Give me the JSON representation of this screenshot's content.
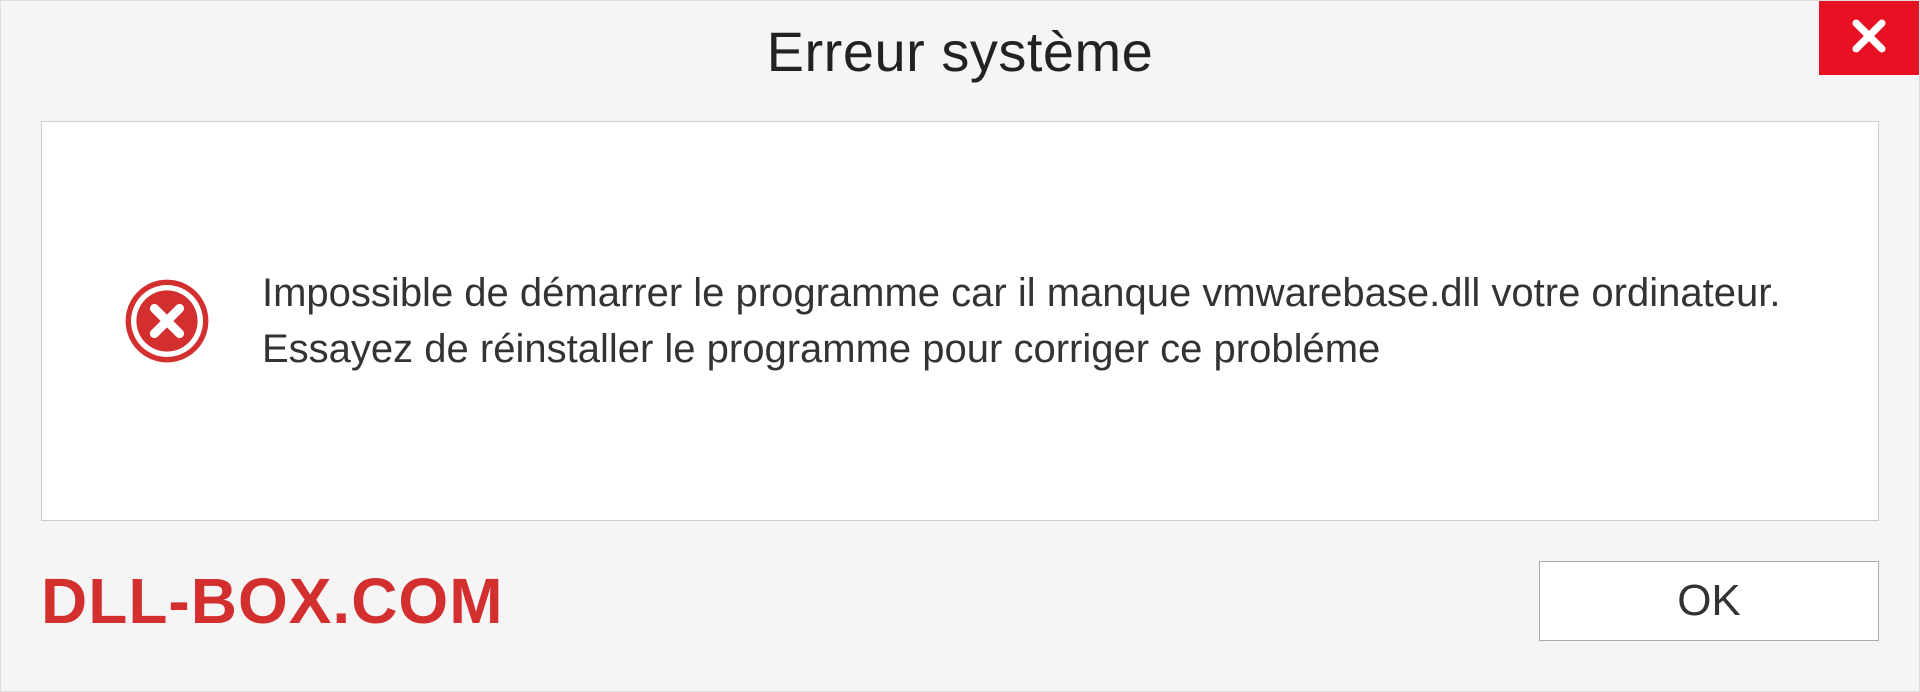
{
  "dialog": {
    "title": "Erreur système",
    "message": "Impossible de démarrer le programme car il manque vmwarebase.dll votre ordinateur. Essayez de réinstaller le programme pour corriger ce probléme",
    "ok_label": "OK",
    "brand": "DLL-BOX.COM"
  },
  "colors": {
    "close_button": "#e81123",
    "brand_text": "#d32f2f",
    "error_icon": "#d32f2f"
  }
}
